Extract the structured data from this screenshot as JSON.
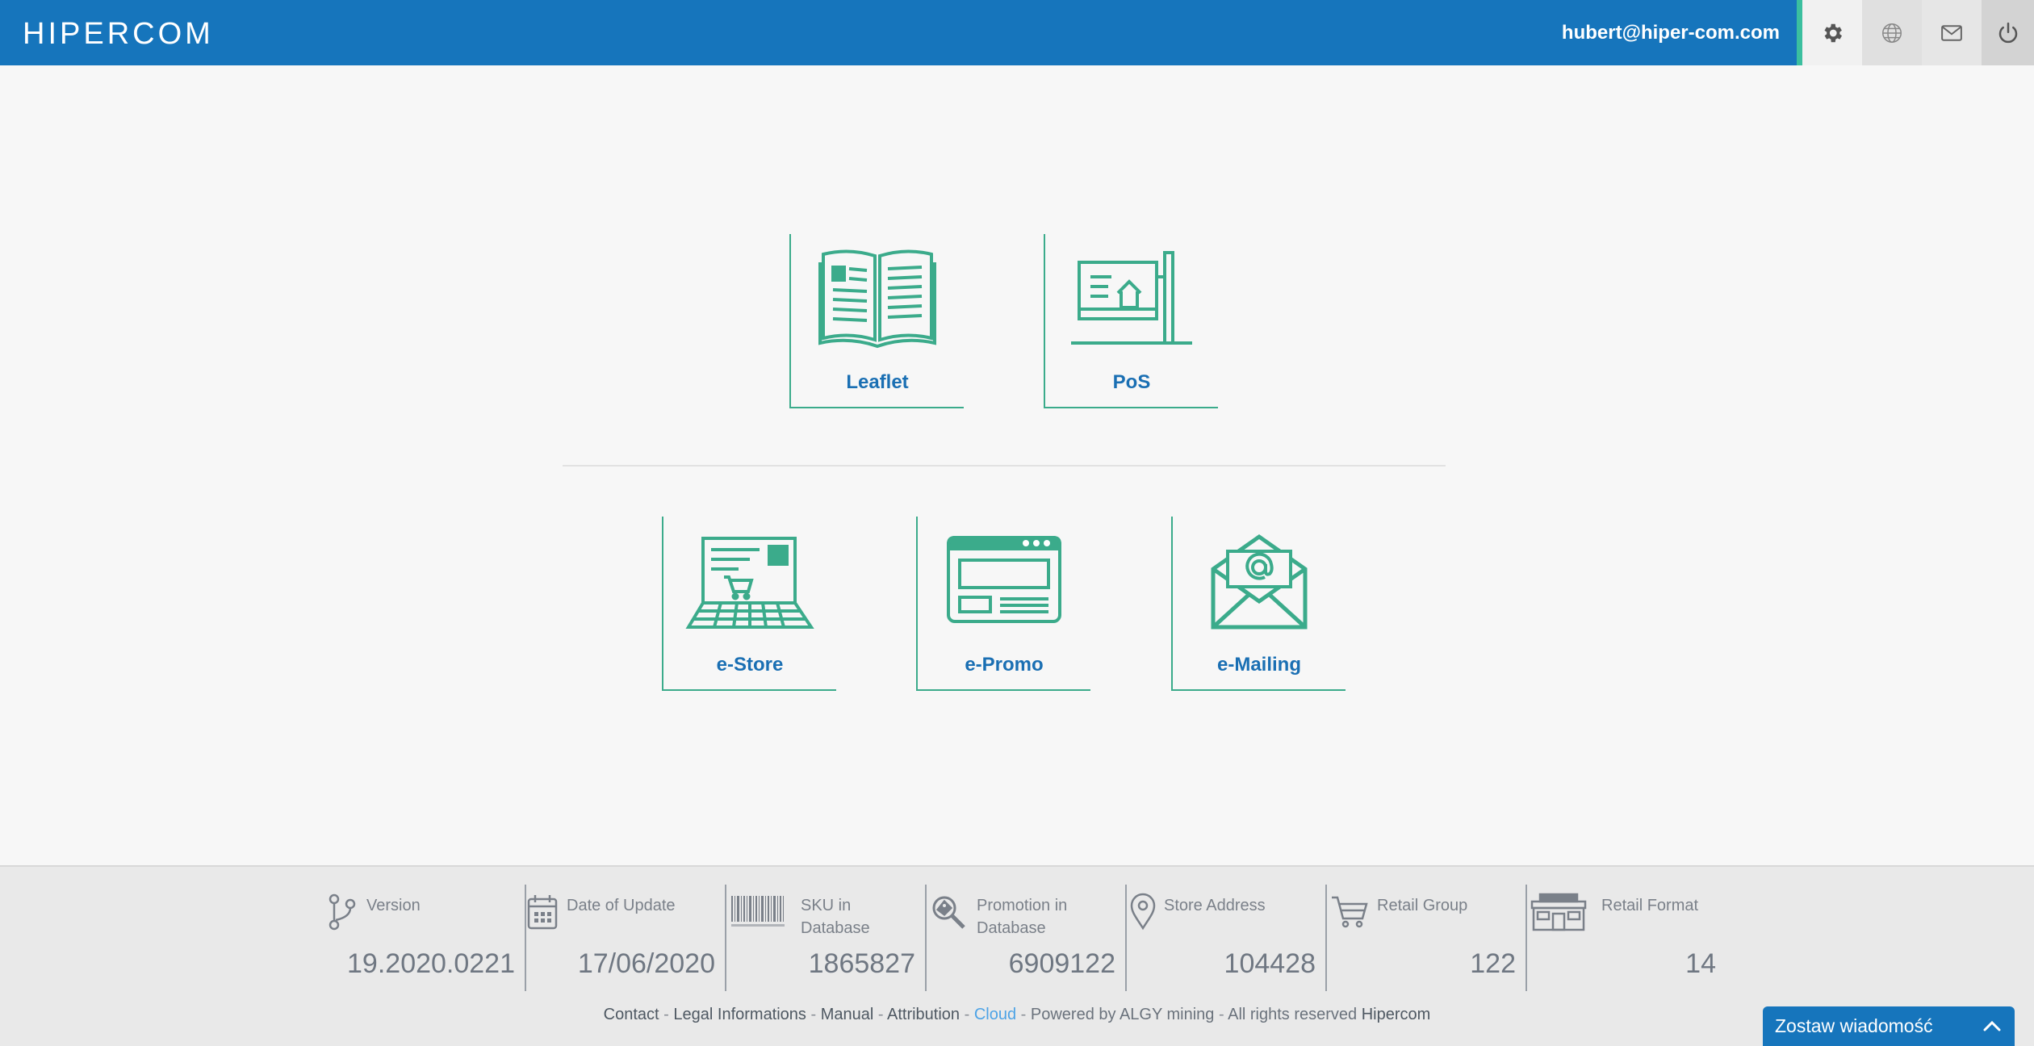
{
  "header": {
    "logo_text": "HIPERCOM",
    "user_email": "hubert@hiper-com.com",
    "buttons": {
      "settings": "gear-icon",
      "language": "globe-icon",
      "messages": "envelope-icon",
      "logout": "power-icon"
    },
    "colors": {
      "bar": "#1675bc",
      "accent": "#3bbf9f"
    }
  },
  "modules_row1": [
    {
      "label": "Leaflet",
      "icon": "open-book-icon"
    },
    {
      "label": "PoS",
      "icon": "store-sign-icon"
    }
  ],
  "modules_row2": [
    {
      "label": "e-Store",
      "icon": "laptop-cart-icon"
    },
    {
      "label": "e-Promo",
      "icon": "browser-window-icon"
    },
    {
      "label": "e-Mailing",
      "icon": "envelope-at-icon"
    }
  ],
  "stats": [
    {
      "label": "Version",
      "value": "19.2020.0221",
      "icon": "branch-icon"
    },
    {
      "label": "Date of Update",
      "value": "17/06/2020",
      "icon": "calendar-icon"
    },
    {
      "label": "SKU in Database",
      "value": "1865827",
      "icon": "barcode-icon"
    },
    {
      "label": "Promotion in Database",
      "value": "6909122",
      "icon": "promo-search-icon"
    },
    {
      "label": "Store Address",
      "value": "104428",
      "icon": "map-pin-icon"
    },
    {
      "label": "Retail Group",
      "value": "122",
      "icon": "cart-icon"
    },
    {
      "label": "Retail Format",
      "value": "14",
      "icon": "market-icon"
    }
  ],
  "footer": {
    "contact": "Contact",
    "legal": "Legal Informations",
    "manual": "Manual",
    "attribution": "Attribution",
    "cloud": "Cloud",
    "powered": "Powered by ALGY mining",
    "rights": "All rights reserved",
    "brand": "Hipercom"
  },
  "chat": {
    "label": "Zostaw wiadomość"
  }
}
